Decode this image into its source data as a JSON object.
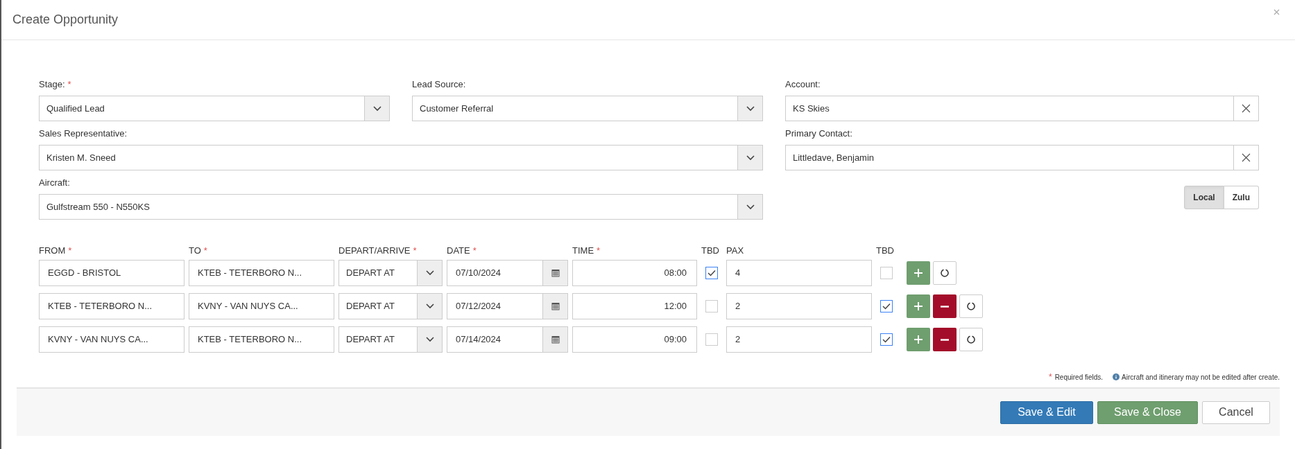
{
  "dialog": {
    "title": "Create Opportunity"
  },
  "fields": [
    {
      "label": "Stage:",
      "required_mark": "*",
      "value": "Qualified Lead",
      "kind": "select"
    },
    {
      "label": "Lead Source:",
      "value": "Customer Referral",
      "kind": "select"
    },
    {
      "label": "Account:",
      "value": "KS Skies",
      "kind": "clearable"
    },
    {
      "label": "Sales Representative:",
      "value": "Kristen M. Sneed",
      "kind": "select"
    },
    {
      "label": "Primary Contact:",
      "value": "Littledave, Benjamin",
      "kind": "clearable"
    },
    {
      "label": "Aircraft:",
      "value": "Gulfstream 550 - N550KS",
      "kind": "select"
    }
  ],
  "time_mode": [
    {
      "label": "Local",
      "selected": true
    },
    {
      "label": "Zulu",
      "selected": false
    }
  ],
  "itinerary": {
    "columns": [
      {
        "label": "FROM",
        "required_mark": "*"
      },
      {
        "label": "TO",
        "required_mark": "*"
      },
      {
        "label": "DEPART/ARRIVE",
        "required_mark": "*"
      },
      {
        "label": "DATE",
        "required_mark": "*"
      },
      {
        "label": "TIME",
        "required_mark": "*"
      },
      {
        "label": "TBD"
      },
      {
        "label": "PAX"
      },
      {
        "label": "TBD"
      }
    ],
    "rows": [
      {
        "from": "EGGD - BRISTOL",
        "to": "KTEB - TETERBORO N...",
        "depart_arrive": "DEPART AT",
        "date": "07/10/2024",
        "time": "08:00",
        "time_tbd": true,
        "pax": "4",
        "pax_tbd": false,
        "removable": false
      },
      {
        "from": "KTEB - TETERBORO N...",
        "to": "KVNY - VAN NUYS CA...",
        "depart_arrive": "DEPART AT",
        "date": "07/12/2024",
        "time": "12:00",
        "time_tbd": false,
        "pax": "2",
        "pax_tbd": true,
        "removable": true
      },
      {
        "from": "KVNY - VAN NUYS CA...",
        "to": "KTEB - TETERBORO N...",
        "depart_arrive": "DEPART AT",
        "date": "07/14/2024",
        "time": "09:00",
        "time_tbd": false,
        "pax": "2",
        "pax_tbd": true,
        "removable": true
      }
    ]
  },
  "notes": {
    "required_mark": "*",
    "required": "Required fields.",
    "info": "Aircraft and itinerary may not be edited after create."
  },
  "buttons": [
    {
      "label": "Save & Edit",
      "kind": "primary"
    },
    {
      "label": "Save & Close",
      "kind": "success"
    },
    {
      "label": "Cancel",
      "kind": "default"
    }
  ]
}
